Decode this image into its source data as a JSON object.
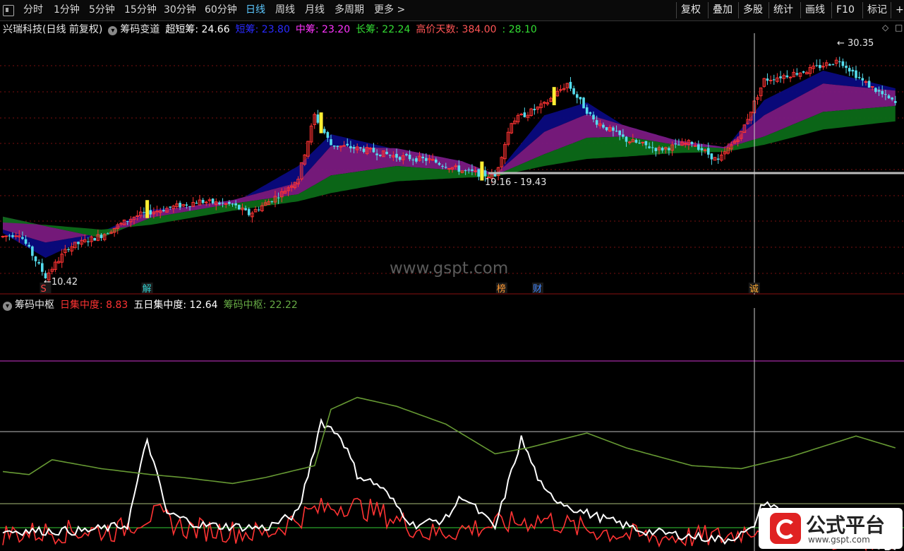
{
  "toolbar": {
    "periods": [
      "分时",
      "1分钟",
      "5分钟",
      "15分钟",
      "30分钟",
      "60分钟",
      "日线",
      "周线",
      "月线",
      "多周期",
      "更多 >"
    ],
    "active_period": "日线",
    "tools": [
      "复权",
      "叠加",
      "多股",
      "统计",
      "画线",
      "F10",
      "标记",
      "+自"
    ]
  },
  "main_header": {
    "stock": "兴瑞科技(日线 前复权)",
    "indicator": "筹码变道",
    "items": [
      {
        "label": "超短筹",
        "value": "24.66",
        "color": "#ffffff"
      },
      {
        "label": "短筹",
        "value": "23.80",
        "color": "#2a2aff"
      },
      {
        "label": "中筹",
        "value": "23.20",
        "color": "#ff33ff"
      },
      {
        "label": "长筹",
        "value": "22.24",
        "color": "#33dd33"
      },
      {
        "label": "高价天数",
        "value": "384.00",
        "color": "#ff5555"
      },
      {
        "label": "",
        "value": "28.10",
        "color": "#33dd33"
      }
    ]
  },
  "sub_header": {
    "indicator": "筹码中枢",
    "items": [
      {
        "label": "日集中度",
        "value": "8.83",
        "color": "#ff3333"
      },
      {
        "label": "五日集中度",
        "value": "12.64",
        "color": "#ffffff"
      },
      {
        "label": "筹码中枢",
        "value": "22.22",
        "color": "#66aa44"
      }
    ]
  },
  "annotations": {
    "high": "30.35",
    "low": "10.42",
    "range": "19.16 - 19.43",
    "watermark": "www.gspt.com",
    "logo_text": "公式平台",
    "logo_url": "www.gspt.com",
    "event_markers": [
      {
        "text": "S",
        "color": "#ff4444",
        "index": 13
      },
      {
        "text": "解",
        "color": "#33cccc",
        "index": 44
      },
      {
        "text": "榜",
        "color": "#ff9933",
        "index": 152
      },
      {
        "text": "财",
        "color": "#4488ff",
        "index": 163
      },
      {
        "text": "诚",
        "color": "#ffaa33",
        "index": 229
      }
    ]
  },
  "colors": {
    "up": "#ff3333",
    "down": "#55ddee",
    "signal": "#ffee33",
    "ultra_short": "#0a0a80",
    "short": "#7a1a80",
    "long": "#0c6a18",
    "ref_line": "#bbbbbb"
  },
  "chart_data": [
    {
      "type": "candlestick",
      "title": "兴瑞科技(日线 前复权)",
      "ylim": [
        10,
        31
      ],
      "current_price": "24.66",
      "high_label": "30.35",
      "low_label": "10.42",
      "reference_level": 19.3,
      "anchors": [
        [
          0,
          14.2
        ],
        [
          5,
          14.5
        ],
        [
          13,
          10.8
        ],
        [
          20,
          13.3
        ],
        [
          30,
          14.3
        ],
        [
          40,
          15.9
        ],
        [
          45,
          16.3
        ],
        [
          60,
          17.2
        ],
        [
          70,
          16.9
        ],
        [
          75,
          16.1
        ],
        [
          85,
          17.9
        ],
        [
          90,
          19.2
        ],
        [
          95,
          24.5
        ],
        [
          100,
          22.0
        ],
        [
          110,
          21.6
        ],
        [
          120,
          21.0
        ],
        [
          130,
          20.7
        ],
        [
          140,
          19.8
        ],
        [
          150,
          19.3
        ],
        [
          155,
          24.0
        ],
        [
          165,
          25.4
        ],
        [
          172,
          27.2
        ],
        [
          180,
          24.1
        ],
        [
          190,
          22.4
        ],
        [
          200,
          21.6
        ],
        [
          210,
          22.2
        ],
        [
          218,
          20.6
        ],
        [
          225,
          23.0
        ],
        [
          232,
          27.5
        ],
        [
          245,
          28.3
        ],
        [
          255,
          29.2
        ],
        [
          262,
          27.4
        ],
        [
          272,
          25.5
        ]
      ],
      "bands": {
        "ultra_short": [
          [
            0,
            14.5
          ],
          [
            13,
            12.4
          ],
          [
            30,
            14.6
          ],
          [
            45,
            16.5
          ],
          [
            70,
            17.0
          ],
          [
            90,
            20.2
          ],
          [
            100,
            22.9
          ],
          [
            120,
            21.6
          ],
          [
            140,
            20.4
          ],
          [
            150,
            19.4
          ],
          [
            165,
            24.5
          ],
          [
            178,
            25.6
          ],
          [
            190,
            23.5
          ],
          [
            205,
            22.1
          ],
          [
            220,
            21.6
          ],
          [
            232,
            25.8
          ],
          [
            250,
            28.3
          ],
          [
            272,
            26.8
          ]
        ],
        "short": [
          [
            0,
            14.8
          ],
          [
            13,
            13.7
          ],
          [
            30,
            14.5
          ],
          [
            45,
            16.3
          ],
          [
            70,
            17.3
          ],
          [
            90,
            18.8
          ],
          [
            100,
            21.9
          ],
          [
            120,
            21.7
          ],
          [
            140,
            20.6
          ],
          [
            150,
            19.5
          ],
          [
            165,
            23.1
          ],
          [
            178,
            24.6
          ],
          [
            190,
            23.6
          ],
          [
            205,
            22.4
          ],
          [
            220,
            21.8
          ],
          [
            232,
            24.5
          ],
          [
            250,
            27.2
          ],
          [
            272,
            26.6
          ]
        ],
        "mid": [
          [
            0,
            15.9
          ],
          [
            13,
            15.1
          ],
          [
            30,
            14.1
          ],
          [
            45,
            15.8
          ],
          [
            70,
            17.0
          ],
          [
            90,
            17.8
          ],
          [
            100,
            19.4
          ],
          [
            120,
            20.2
          ],
          [
            140,
            19.8
          ],
          [
            150,
            19.4
          ],
          [
            165,
            21.2
          ],
          [
            178,
            22.6
          ],
          [
            190,
            22.7
          ],
          [
            205,
            22.0
          ],
          [
            220,
            21.7
          ],
          [
            232,
            22.7
          ],
          [
            250,
            24.8
          ],
          [
            272,
            25.3
          ]
        ],
        "long": [
          [
            0,
            15.4
          ],
          [
            13,
            15.2
          ],
          [
            30,
            14.8
          ],
          [
            45,
            15.2
          ],
          [
            70,
            16.4
          ],
          [
            90,
            17.2
          ],
          [
            100,
            17.9
          ],
          [
            120,
            18.9
          ],
          [
            140,
            19.2
          ],
          [
            150,
            19.3
          ],
          [
            165,
            20.2
          ],
          [
            178,
            20.8
          ],
          [
            190,
            21.0
          ],
          [
            205,
            21.3
          ],
          [
            220,
            21.4
          ],
          [
            232,
            22.0
          ],
          [
            250,
            23.3
          ],
          [
            272,
            24.0
          ]
        ]
      },
      "signal_bars": [
        44,
        97,
        146,
        168
      ]
    },
    {
      "type": "line",
      "title": "筹码中枢",
      "ylim": [
        0,
        100
      ],
      "reference_lines": [
        90,
        52,
        11,
        -1
      ],
      "series": [
        {
          "name": "日集中度",
          "color": "#ff3333",
          "points": [
            [
              0,
              -9
            ],
            [
              25,
              -8
            ],
            [
              35,
              -8
            ],
            [
              44,
              -3
            ],
            [
              48,
              -3
            ],
            [
              55,
              -7
            ],
            [
              80,
              -9
            ],
            [
              95,
              -1
            ],
            [
              105,
              1
            ],
            [
              115,
              -2
            ],
            [
              130,
              -9
            ],
            [
              150,
              -6
            ],
            [
              165,
              -4
            ],
            [
              175,
              -7
            ],
            [
              195,
              -10
            ],
            [
              220,
              -10
            ],
            [
              232,
              -6
            ],
            [
              250,
              -11
            ],
            [
              272,
              -11
            ]
          ]
        },
        {
          "name": "五日集中度",
          "color": "#ffffff",
          "points": [
            [
              0,
              -8
            ],
            [
              25,
              -8
            ],
            [
              38,
              -6
            ],
            [
              44,
              23
            ],
            [
              50,
              -2
            ],
            [
              60,
              -6
            ],
            [
              80,
              -7
            ],
            [
              90,
              -2
            ],
            [
              97,
              29
            ],
            [
              103,
              24
            ],
            [
              108,
              11
            ],
            [
              115,
              7
            ],
            [
              125,
              -6
            ],
            [
              135,
              -4
            ],
            [
              140,
              4
            ],
            [
              150,
              -7
            ],
            [
              158,
              23
            ],
            [
              165,
              5
            ],
            [
              175,
              -1
            ],
            [
              195,
              -8
            ],
            [
              220,
              -11
            ],
            [
              228,
              -8
            ],
            [
              232,
              2
            ],
            [
              250,
              -10
            ],
            [
              272,
              -14
            ]
          ]
        },
        {
          "name": "筹码中枢",
          "color": "#669933",
          "points": [
            [
              0,
              12
            ],
            [
              8,
              11
            ],
            [
              15,
              16
            ],
            [
              30,
              13
            ],
            [
              45,
              11
            ],
            [
              55,
              10
            ],
            [
              70,
              8
            ],
            [
              80,
              10
            ],
            [
              95,
              14
            ],
            [
              100,
              33
            ],
            [
              108,
              37
            ],
            [
              120,
              34
            ],
            [
              135,
              28
            ],
            [
              150,
              18
            ],
            [
              160,
              20
            ],
            [
              178,
              25
            ],
            [
              190,
              20
            ],
            [
              210,
              14
            ],
            [
              225,
              13
            ],
            [
              240,
              17
            ],
            [
              260,
              24
            ],
            [
              272,
              20
            ]
          ]
        }
      ]
    }
  ]
}
